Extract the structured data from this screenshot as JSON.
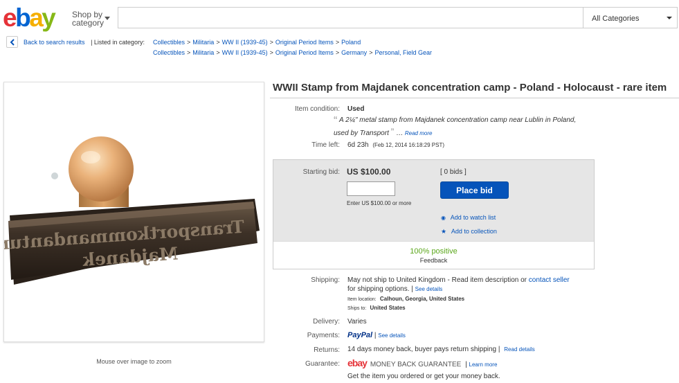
{
  "header": {
    "logo": [
      "e",
      "b",
      "a",
      "y"
    ],
    "shop_by_label_1": "Shop by",
    "shop_by_label_2": "category",
    "search_placeholder": "",
    "category_selected": "All Categories"
  },
  "breadcrumbs": {
    "back_label": "Back to search results",
    "listed_in": "| Listed in category:",
    "row1": [
      "Collectibles",
      "Militaria",
      "WW II (1939-45)",
      "Original Period Items",
      "Poland"
    ],
    "row2": [
      "Collectibles",
      "Militaria",
      "WW II (1939-45)",
      "Original Period Items",
      "Germany",
      "Personal, Field Gear"
    ]
  },
  "image": {
    "stamp_text_line1": "Transportkommandantur",
    "stamp_text_line2": "Majdanek",
    "zoom_note": "Mouse over image to zoom"
  },
  "item": {
    "title": "WWII Stamp from Majdanek concentration camp - Poland - Holocaust - rare item",
    "condition_label": "Item condition:",
    "condition_value": "Used",
    "condition_quote_line1": "A 2¼\" metal stamp from Majdanek concentration camp near Lublin in Poland,",
    "condition_quote_line2": "used by Transport",
    "read_more": "Read more",
    "time_left_label": "Time left:",
    "time_left_value": "6d 23h",
    "time_left_date": "(Feb 12, 2014   16:18:29 PST)"
  },
  "bid": {
    "starting_bid_label": "Starting bid:",
    "starting_bid_value": "US $100.00",
    "bids_link": "[ 0 bids ]",
    "input_value": "",
    "enter_hint": "Enter US $100.00 or more",
    "place_bid_label": "Place bid",
    "watch_list": "Add to watch list",
    "collection": "Add to collection",
    "positive": "100% positive",
    "feedback": "Feedback"
  },
  "shipping": {
    "label": "Shipping:",
    "text1": "May not ship to United Kingdom - Read item description or",
    "contact_seller": "contact seller",
    "text2": "for shipping options. |",
    "see_details": "See details",
    "item_location_label": "Item location:",
    "item_location": "Calhoun, Georgia, United States",
    "ships_to_label": "Ships to:",
    "ships_to": "United States"
  },
  "delivery": {
    "label": "Delivery:",
    "value": "Varies"
  },
  "payments": {
    "label": "Payments:",
    "paypal": "PayPal",
    "sep": "|",
    "see_details": "See details"
  },
  "returns": {
    "label": "Returns:",
    "value": "14 days money back, buyer pays return shipping |",
    "read_details": "Read details"
  },
  "guarantee": {
    "label": "Guarantee:",
    "ebay": "ebay",
    "text": "MONEY BACK GUARANTEE",
    "learn_more": "Learn more",
    "sub": "Get the item you ordered or get your money back."
  },
  "colors": {
    "link": "#0654ba",
    "button": "#0654ba",
    "positive": "#5ba71b"
  }
}
